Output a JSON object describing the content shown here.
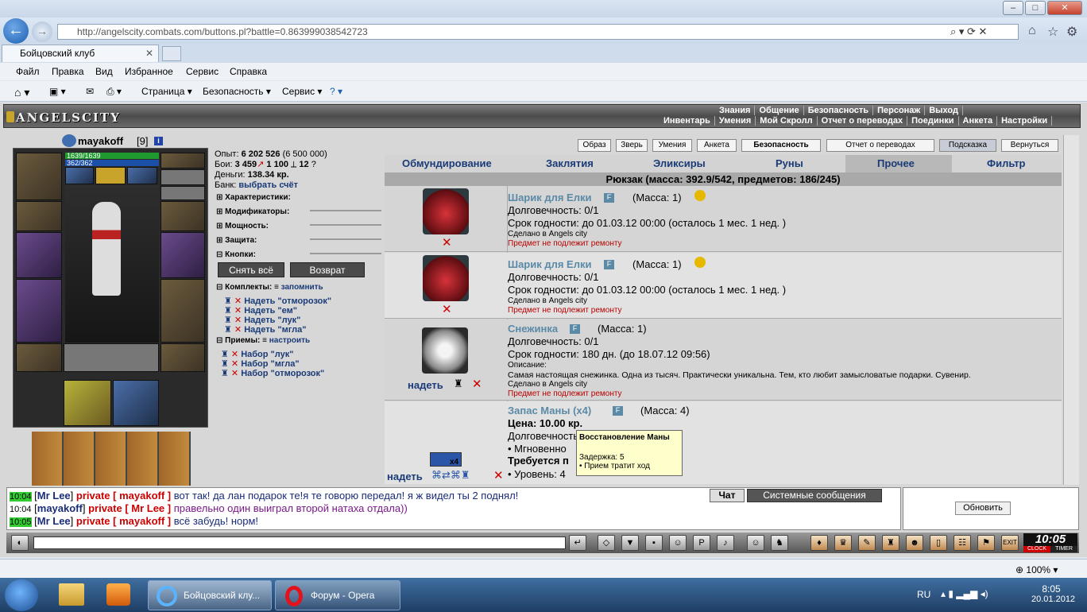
{
  "browser": {
    "address": "http://angelscity.combats.com/buttons.pl?battle=0.863999038542723",
    "tab": "Бойцовский клуб",
    "menu": [
      "Файл",
      "Правка",
      "Вид",
      "Избранное",
      "Сервис",
      "Справка"
    ],
    "cmd": [
      "Страница ▾",
      "Безопасность ▾",
      "Сервис ▾"
    ],
    "zoom": "100%"
  },
  "game": {
    "logo": "ANGELSCITY",
    "topnav1": [
      "Знания",
      "Общение",
      "Безопасность",
      "Персонаж",
      "Выход"
    ],
    "topnav2": [
      "Инвентарь",
      "Умения",
      "Мой Скролл",
      "Отчет о переводах",
      "Поединки",
      "Анкета",
      "Настройки"
    ],
    "buttons": [
      "Образ",
      "Зверь",
      "Умения",
      "Анкета",
      "Безопасность",
      "Отчет о переводах",
      "Подсказка",
      "Вернуться"
    ],
    "char": {
      "name": "mayakoff",
      "level": "[9]",
      "hp": "1639/1639",
      "mp": "362/362"
    },
    "stats": {
      "exp_label": "Опыт:",
      "exp": "6 202 526",
      "exp_next": "(6 500 000)",
      "fights_label": "Бои:",
      "wins": "3 459",
      "losses": "1 100",
      "draws": "12",
      "money_label": "Деньги:",
      "money": "138.34 кр.",
      "bank_label": "Банк:",
      "bank": "выбрать счёт"
    },
    "sections": [
      "Характеристики:",
      "Модификаторы:",
      "Мощность:",
      "Защита:",
      "Кнопки:"
    ],
    "action_buttons": [
      "Снять всё",
      "Возврат"
    ],
    "sets_label": "Комплекты:",
    "sets_link": "запомнить",
    "sets": [
      "Надеть \"отморозок\"",
      "Надеть \"ем\"",
      "Надеть \"лук\"",
      "Надеть \"мгла\""
    ],
    "moves_label": "Приемы:",
    "moves_link": "настроить",
    "moves": [
      "Набор \"лук\"",
      "Набор \"мгла\"",
      "Набор \"отморозок\""
    ],
    "tabs": [
      "Обмундирование",
      "Заклятия",
      "Эликсиры",
      "Руны",
      "Прочее",
      "Фильтр"
    ],
    "backpack": "Рюкзак (масса: 392.9/542, предметов: 186/245)",
    "items": [
      {
        "name": "Шарик для Елки",
        "mass": "(Масса: 1)",
        "dur": "Долговечность: 0/1",
        "exp": "Срок годности: до 01.03.12 00:00 (осталось 1 мес. 1 нед. )",
        "made": "Сделано в Angels city",
        "norepair": "Предмет не подлежит ремонту"
      },
      {
        "name": "Шарик для Елки",
        "mass": "(Масса: 1)",
        "dur": "Долговечность: 0/1",
        "exp": "Срок годности: до 01.03.12 00:00 (осталось 1 мес. 1 нед. )",
        "made": "Сделано в Angels city",
        "norepair": "Предмет не подлежит ремонту"
      },
      {
        "name": "Снежинка",
        "mass": "(Масса: 1)",
        "dur": "Долговечность: 0/1",
        "exp": "Срок годности: 180 дн. (до 18.07.12 09:56)",
        "desc_label": "Описание:",
        "desc": "Самая настоящая снежинка. Одна из тысяч. Практически уникальна. Тем, кто любит замысловатые подарки. Сувенир.",
        "made": "Сделано в Angels city",
        "norepair": "Предмет не подлежит ремонту",
        "action": "надеть"
      },
      {
        "name": "Запас Маны (x4)",
        "mass": "(Масса: 4)",
        "price": "Цена: 10.00 кр.",
        "dur": "Долговечность",
        "instant": "• Мгновенно",
        "req": "Требуется п",
        "lvl": "• Уровень: 4",
        "action": "надеть",
        "count": "x4"
      }
    ],
    "tooltip": {
      "title": "Восстановление Маны",
      "delay": "Задержка: 5",
      "note": "• Прием тратит ход"
    }
  },
  "chat": {
    "tabs": [
      "Чат",
      "Системные сообщения"
    ],
    "refresh": "Обновить",
    "lines": [
      {
        "time": "10:04",
        "hl": true,
        "nick": "Mr Lee",
        "priv": "private [ mayakoff ]",
        "text": "вот так! да лан подарок те!я те говорю передал! я ж видел ты 2 поднял!"
      },
      {
        "time": "10:04",
        "hl": false,
        "nick": "mayakoff",
        "priv": "private [ Mr Lee ]",
        "text": "правельно один выиграл второй натаха отдала))"
      },
      {
        "time": "10:05",
        "hl": true,
        "nick": "Mr Lee",
        "priv": "private [ mayakoff ]",
        "text": "всё забудь! норм!"
      }
    ],
    "clock": "10:05",
    "clock_label": "CLOCK",
    "timer_label": "TIMER"
  },
  "taskbar": {
    "items": [
      "Бойцовский клу...",
      "Форум - Opera"
    ],
    "lang": "RU",
    "time": "8:05",
    "date": "20.01.2012"
  }
}
